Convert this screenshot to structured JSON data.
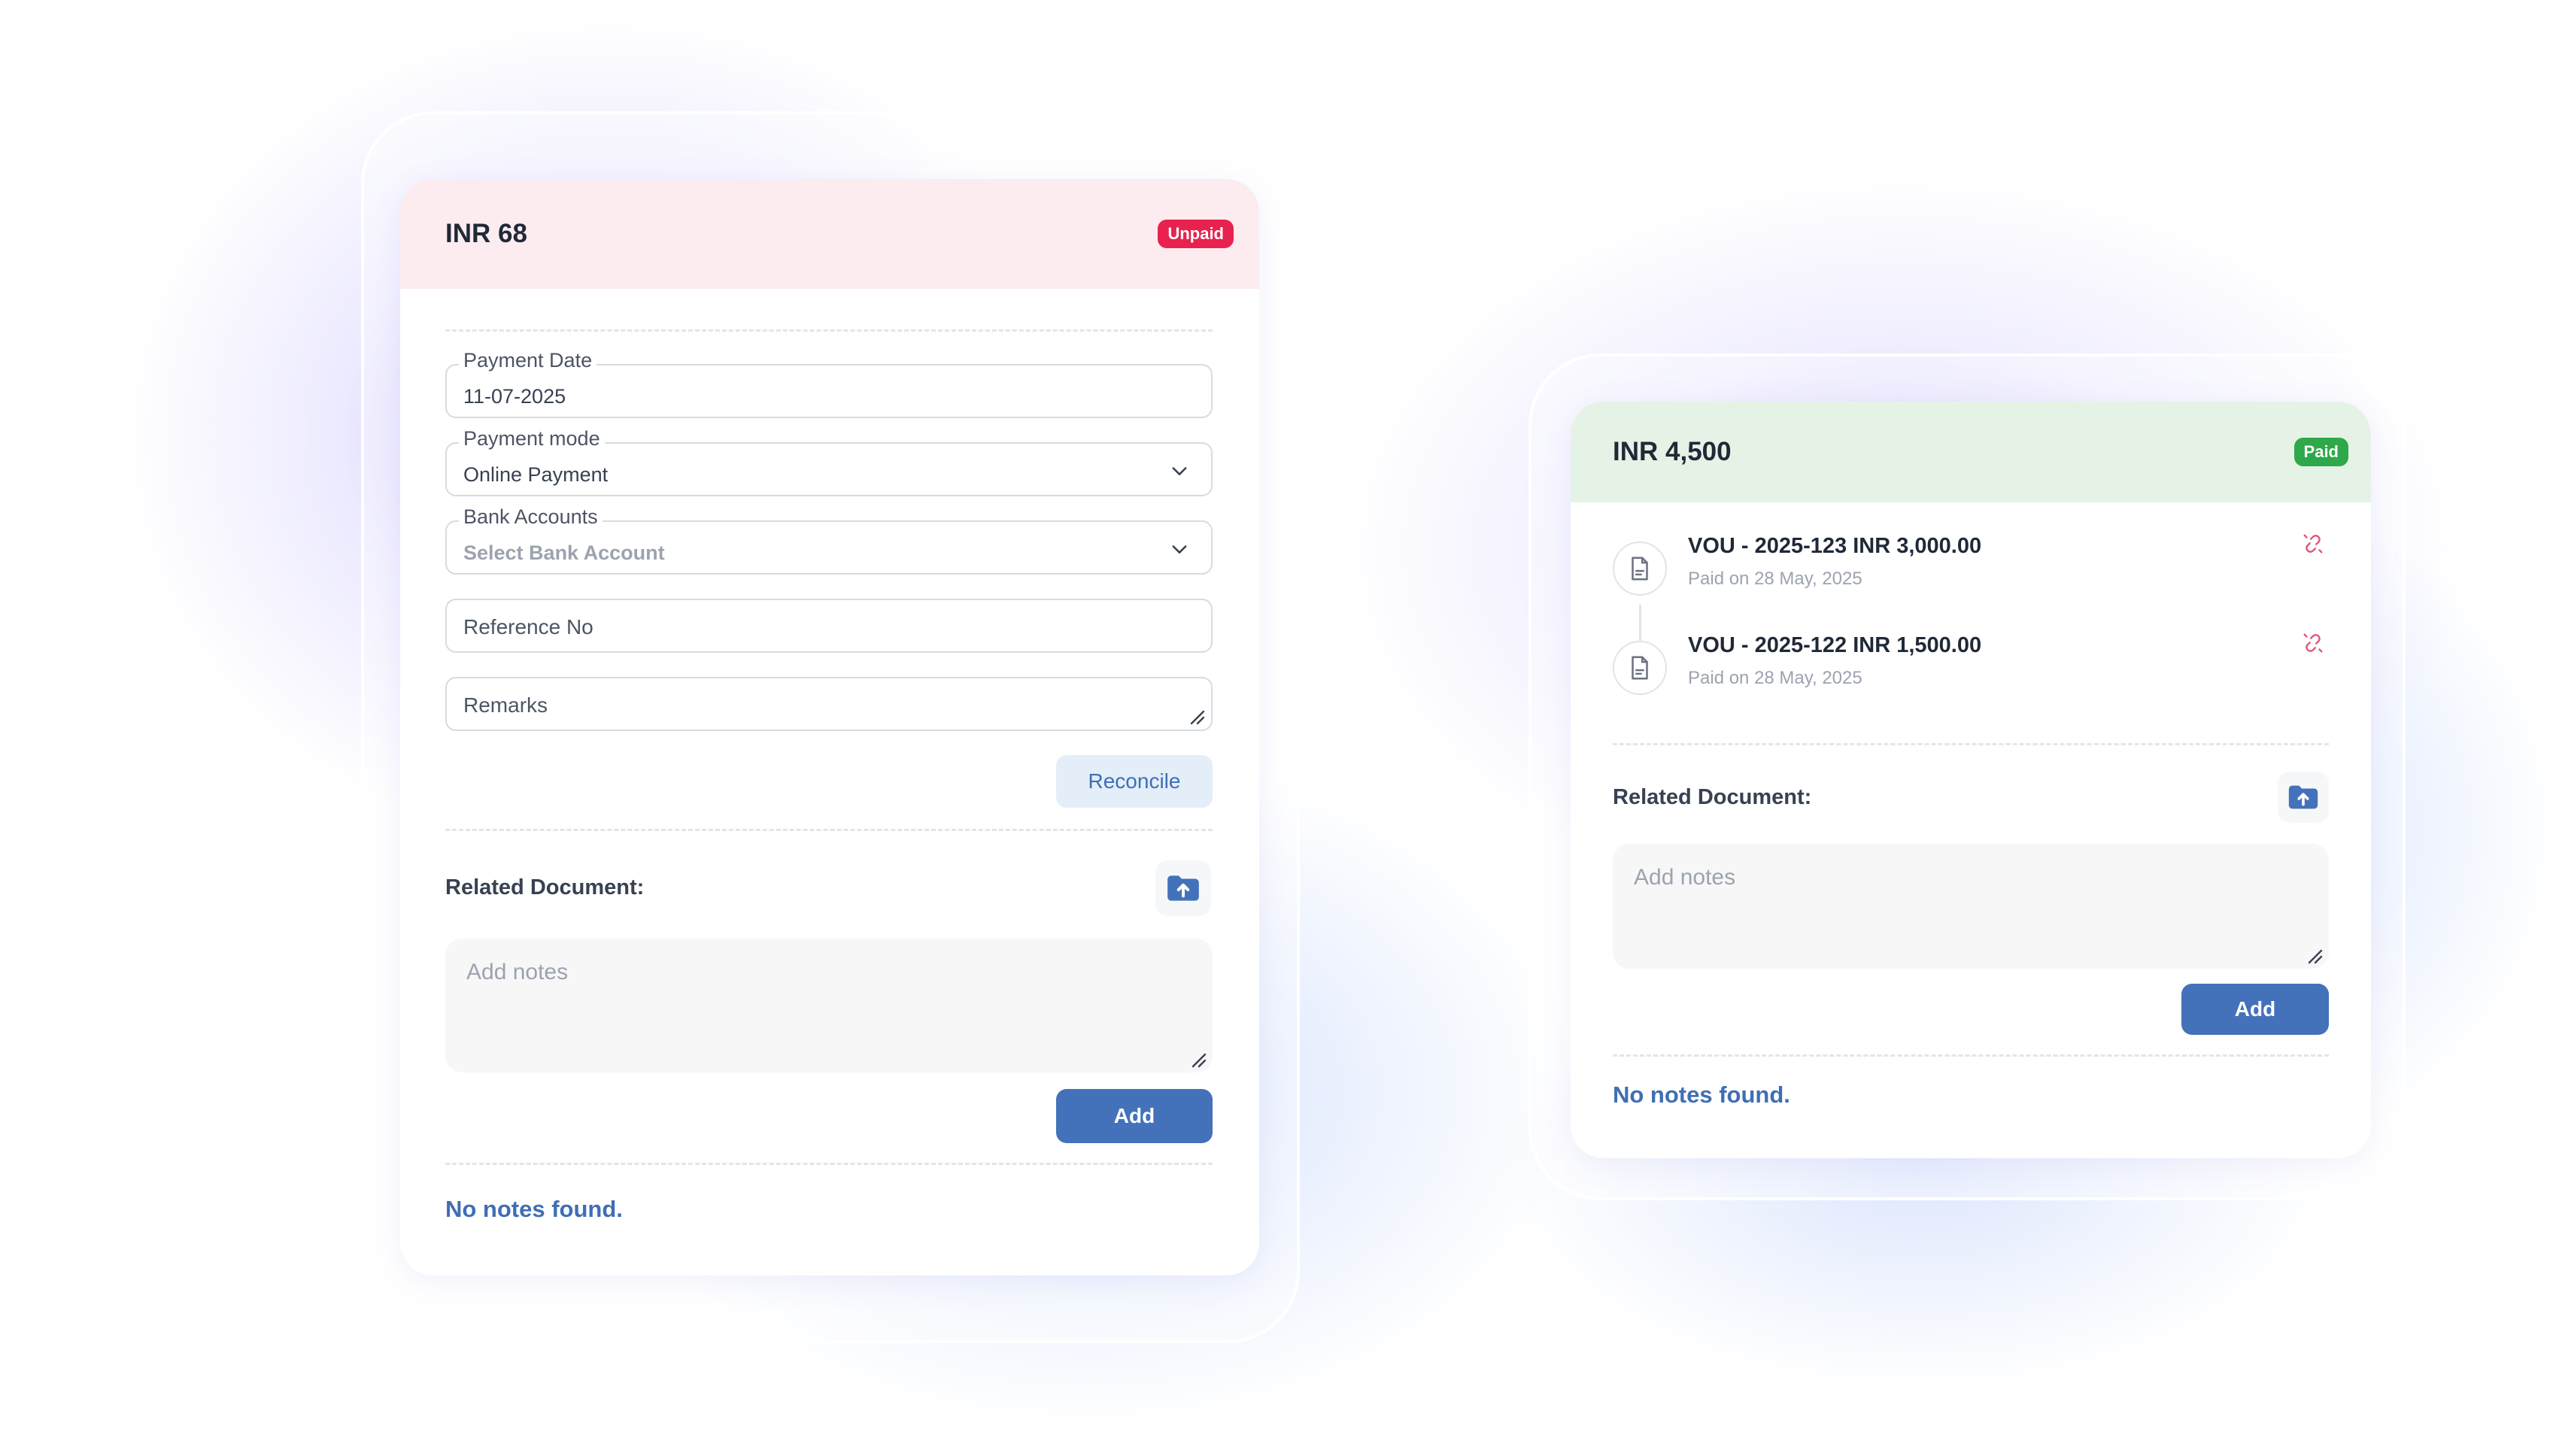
{
  "left_card": {
    "amount": "INR 68",
    "status": "Unpaid",
    "status_color": "#e8224f",
    "header_bg": "#fdecef",
    "payment_date": {
      "label": "Payment Date",
      "value": "11-07-2025"
    },
    "payment_mode": {
      "label": "Payment mode",
      "value": "Online Payment"
    },
    "bank_accounts": {
      "label": "Bank Accounts",
      "placeholder": "Select Bank Account"
    },
    "reference_no": {
      "placeholder": "Reference No"
    },
    "remarks": {
      "placeholder": "Remarks"
    },
    "reconcile_label": "Reconcile",
    "related_document_label": "Related Document:",
    "notes_placeholder": "Add notes",
    "add_label": "Add",
    "no_notes": "No notes found."
  },
  "right_card": {
    "amount": "INR 4,500",
    "status": "Paid",
    "status_color": "#2ea84a",
    "header_bg": "#e5f3e6",
    "vouchers": [
      {
        "title": "VOU - 2025-123 INR 3,000.00",
        "subtitle": "Paid on 28 May, 2025"
      },
      {
        "title": "VOU - 2025-122 INR 1,500.00",
        "subtitle": "Paid on 28 May, 2025"
      }
    ],
    "related_document_label": "Related Document:",
    "notes_placeholder": "Add notes",
    "add_label": "Add",
    "no_notes": "No notes found."
  },
  "colors": {
    "accent": "#4472ba",
    "link": "#3f6eb4",
    "unlink_icon": "#e0557a"
  }
}
